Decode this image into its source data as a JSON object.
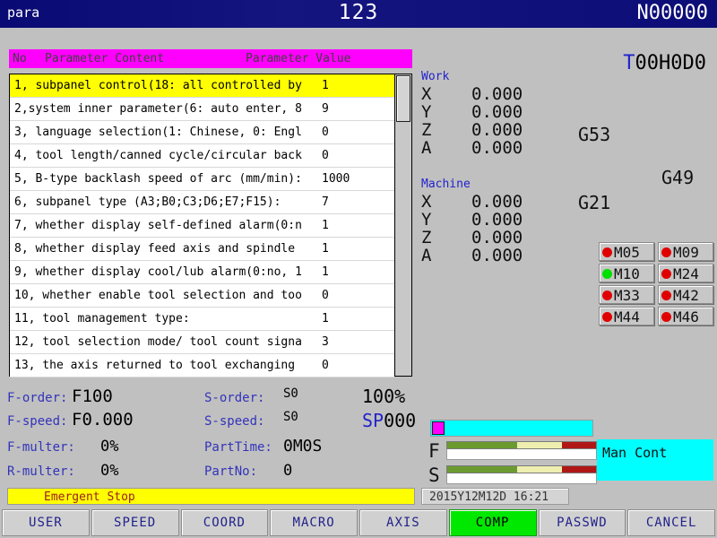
{
  "titlebar": {
    "mode": "para",
    "program": "123",
    "block": "N00000"
  },
  "param_table": {
    "header": {
      "no": "No",
      "content": "Parameter Content",
      "value": "Parameter Value"
    },
    "rows": [
      {
        "text": "1, subpanel control(18: all controlled by",
        "value": "1",
        "selected": true
      },
      {
        "text": "2,system inner parameter(6: auto enter, 8",
        "value": "9",
        "selected": false
      },
      {
        "text": "3, language selection(1: Chinese, 0: Engl",
        "value": "0",
        "selected": false
      },
      {
        "text": "4, tool length/canned cycle/circular back",
        "value": "0",
        "selected": false
      },
      {
        "text": "5, B-type backlash speed of arc (mm/min):",
        "value": "1000",
        "selected": false
      },
      {
        "text": "6, subpanel type (A3;B0;C3;D6;E7;F15):",
        "value": "7",
        "selected": false
      },
      {
        "text": "7, whether display self-defined alarm(0:n",
        "value": "1",
        "selected": false
      },
      {
        "text": "8, whether display feed axis and spindle",
        "value": "1",
        "selected": false
      },
      {
        "text": "9, whether display cool/lub alarm(0:no, 1",
        "value": "1",
        "selected": false
      },
      {
        "text": "10, whether enable tool selection and too",
        "value": "0",
        "selected": false
      },
      {
        "text": "11, tool management type:",
        "value": "1",
        "selected": false
      },
      {
        "text": "12, tool selection mode/ tool count signa",
        "value": "3",
        "selected": false
      },
      {
        "text": "13, the axis returned to tool exchanging",
        "value": "0",
        "selected": false
      }
    ]
  },
  "status": {
    "tool_prefix": "T",
    "tool_id": "00H0D0",
    "work": {
      "label": "Work",
      "axes": [
        {
          "axis": "X",
          "value": "0.000"
        },
        {
          "axis": "Y",
          "value": "0.000"
        },
        {
          "axis": "Z",
          "value": "0.000"
        },
        {
          "axis": "A",
          "value": "0.000"
        }
      ]
    },
    "machine": {
      "label": "Machine",
      "axes": [
        {
          "axis": "X",
          "value": "0.000"
        },
        {
          "axis": "Y",
          "value": "0.000"
        },
        {
          "axis": "Z",
          "value": "0.000"
        },
        {
          "axis": "A",
          "value": "0.000"
        }
      ]
    },
    "gcodes": {
      "g53": "G53",
      "g49": "G49",
      "g21": "G21"
    },
    "m_indicators": [
      {
        "label": "M05",
        "on": false
      },
      {
        "label": "M09",
        "on": false
      },
      {
        "label": "M10",
        "on": true
      },
      {
        "label": "M24",
        "on": false
      },
      {
        "label": "M33",
        "on": false
      },
      {
        "label": "M42",
        "on": false
      },
      {
        "label": "M44",
        "on": false
      },
      {
        "label": "M46",
        "on": false
      }
    ]
  },
  "feed_spindle": {
    "f_order_label": "F-order:",
    "f_order_value": "F100",
    "f_speed_label": "F-speed:",
    "f_speed_value": "F0.000",
    "f_multer_label": "F-multer:",
    "f_multer_value": "0%",
    "r_multer_label": "R-multer:",
    "r_multer_value": "0%",
    "s_order_label": "S-order:",
    "s_order_value": "S0",
    "s_speed_label": "S-speed:",
    "s_speed_value": "S0",
    "part_time_label": "PartTime:",
    "part_time_value": "0M0S",
    "part_no_label": "PartNo:",
    "part_no_value": "0",
    "spindle_percent": "100%",
    "sp_prefix": "SP",
    "sp_value": "000"
  },
  "gauges": {
    "f_letter": "F",
    "s_letter": "S"
  },
  "mode_box": {
    "text": "Man Cont"
  },
  "alarm": {
    "text": "Emergent Stop"
  },
  "datetime": {
    "text": "2015Y12M12D 16:21"
  },
  "function_keys": [
    {
      "label": "USER",
      "active": false
    },
    {
      "label": "SPEED",
      "active": false
    },
    {
      "label": "COORD",
      "active": false
    },
    {
      "label": "MACRO",
      "active": false
    },
    {
      "label": "AXIS",
      "active": false
    },
    {
      "label": "COMP",
      "active": true
    },
    {
      "label": "PASSWD",
      "active": false
    },
    {
      "label": "CANCEL",
      "active": false
    }
  ],
  "colors": {
    "titlebar": "#0d0d78",
    "header_magenta": "#ff00ff",
    "selected_row": "#ffff00",
    "accent_blue": "#2222cc",
    "active_key": "#00e800",
    "led_on": "#00e000",
    "led_off": "#e00000",
    "cyan": "#00ffff",
    "alarm_text": "#9a2020"
  }
}
